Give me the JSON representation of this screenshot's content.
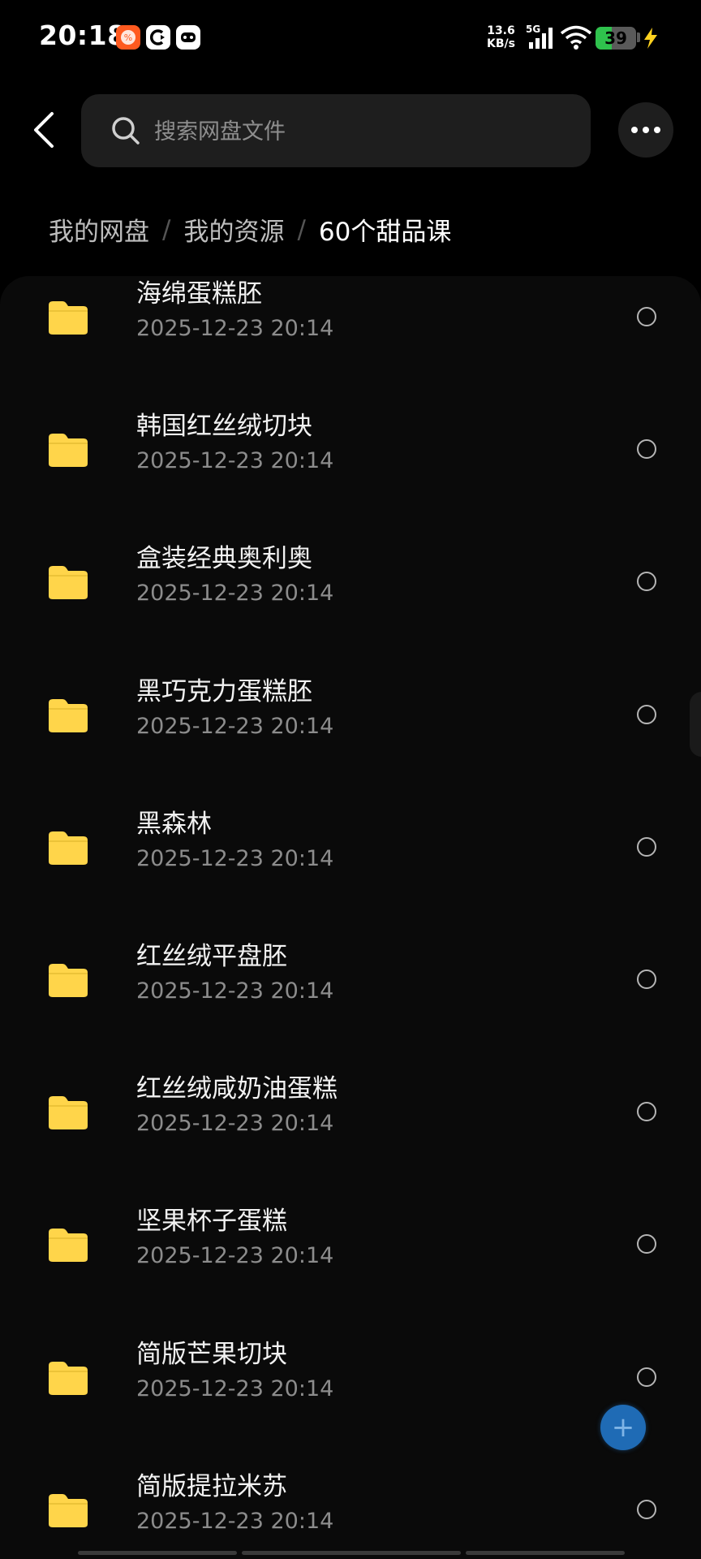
{
  "status_bar": {
    "time": "20:18",
    "net_speed_value": "13.6",
    "net_speed_unit": "KB/s",
    "signal_type": "5G",
    "battery_level": "39",
    "battery_percent": 39,
    "charging": true
  },
  "header": {
    "search_placeholder": "搜索网盘文件"
  },
  "breadcrumb": {
    "root": "我的网盘",
    "middle": "我的资源",
    "current": "60个甜品课",
    "separator": "/"
  },
  "files": [
    {
      "name": "海绵蛋糕胚",
      "date": "2025-12-23  20:14"
    },
    {
      "name": "韩国红丝绒切块",
      "date": "2025-12-23  20:14"
    },
    {
      "name": "盒装经典奥利奥",
      "date": "2025-12-23  20:14"
    },
    {
      "name": "黑巧克力蛋糕胚",
      "date": "2025-12-23  20:14"
    },
    {
      "name": "黑森林",
      "date": "2025-12-23  20:14"
    },
    {
      "name": "红丝绒平盘胚",
      "date": "2025-12-23  20:14"
    },
    {
      "name": "红丝绒咸奶油蛋糕",
      "date": "2025-12-23  20:14"
    },
    {
      "name": "坚果杯子蛋糕",
      "date": "2025-12-23  20:14"
    },
    {
      "name": "简版芒果切块",
      "date": "2025-12-23  20:14"
    },
    {
      "name": "简版提拉米苏",
      "date": "2025-12-23  20:14"
    }
  ],
  "fab": {
    "label": "+"
  },
  "colors": {
    "background": "#000000",
    "folder": "#ffd54a",
    "battery": "#2fc24d",
    "fab": "#1f6bb5"
  },
  "icons": {
    "back": "chevron-left-icon",
    "search": "search-icon",
    "more": "more-dots-icon",
    "folder": "folder-icon",
    "select": "radio-circle-icon"
  }
}
